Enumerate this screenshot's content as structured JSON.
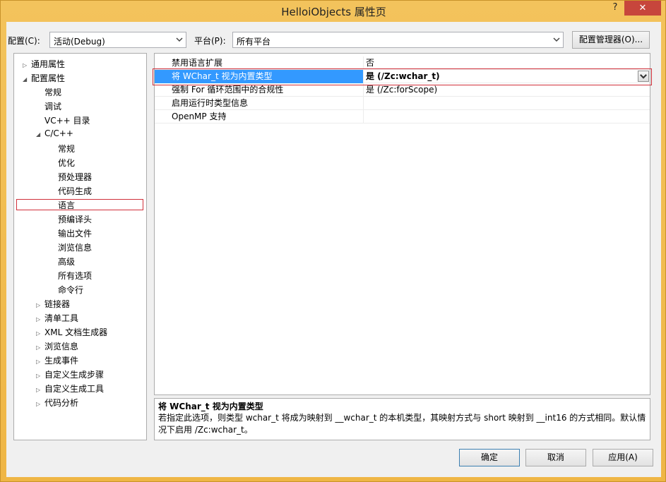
{
  "window": {
    "title": "HelloiObjects 属性页",
    "help_label": "?",
    "close_label": "✕"
  },
  "toolbar": {
    "config_label": "配置(C):",
    "config_value": "活动(Debug)",
    "platform_label": "平台(P):",
    "platform_value": "所有平台",
    "config_manager_label": "配置管理器(O)..."
  },
  "tree": {
    "items": [
      {
        "label": "通用属性",
        "level": 0,
        "expander": "▷"
      },
      {
        "label": "配置属性",
        "level": 0,
        "expander": "◢"
      },
      {
        "label": "常规",
        "level": 1,
        "expander": ""
      },
      {
        "label": "调试",
        "level": 1,
        "expander": ""
      },
      {
        "label": "VC++ 目录",
        "level": 1,
        "expander": ""
      },
      {
        "label": "C/C++",
        "level": 1,
        "expander": "◢"
      },
      {
        "label": "常规",
        "level": 2,
        "expander": ""
      },
      {
        "label": "优化",
        "level": 2,
        "expander": ""
      },
      {
        "label": "预处理器",
        "level": 2,
        "expander": ""
      },
      {
        "label": "代码生成",
        "level": 2,
        "expander": ""
      },
      {
        "label": "语言",
        "level": 2,
        "expander": "",
        "selected": true
      },
      {
        "label": "预编译头",
        "level": 2,
        "expander": ""
      },
      {
        "label": "输出文件",
        "level": 2,
        "expander": ""
      },
      {
        "label": "浏览信息",
        "level": 2,
        "expander": ""
      },
      {
        "label": "高级",
        "level": 2,
        "expander": ""
      },
      {
        "label": "所有选项",
        "level": 2,
        "expander": ""
      },
      {
        "label": "命令行",
        "level": 2,
        "expander": ""
      },
      {
        "label": "链接器",
        "level": 1,
        "expander": "▷"
      },
      {
        "label": "清单工具",
        "level": 1,
        "expander": "▷"
      },
      {
        "label": "XML 文档生成器",
        "level": 1,
        "expander": "▷"
      },
      {
        "label": "浏览信息",
        "level": 1,
        "expander": "▷"
      },
      {
        "label": "生成事件",
        "level": 1,
        "expander": "▷"
      },
      {
        "label": "自定义生成步骤",
        "level": 1,
        "expander": "▷"
      },
      {
        "label": "自定义生成工具",
        "level": 1,
        "expander": "▷"
      },
      {
        "label": "代码分析",
        "level": 1,
        "expander": "▷"
      }
    ]
  },
  "properties": {
    "rows": [
      {
        "key": "禁用语言扩展",
        "value": "否"
      },
      {
        "key": "将 WChar_t 视为内置类型",
        "value": "是 (/Zc:wchar_t)",
        "selected": true
      },
      {
        "key": "强制 For 循环范围中的合规性",
        "value": "是 (/Zc:forScope)"
      },
      {
        "key": "启用运行时类型信息",
        "value": ""
      },
      {
        "key": "OpenMP 支持",
        "value": ""
      }
    ]
  },
  "description": {
    "title": "将 WChar_t 视为内置类型",
    "text": "若指定此选项，则类型 wchar_t 将成为映射到 __wchar_t 的本机类型，其映射方式与 short 映射到 __int16 的方式相同。默认情况下启用 /Zc:wchar_t。"
  },
  "buttons": {
    "ok": "确定",
    "cancel": "取消",
    "apply": "应用(A)"
  }
}
